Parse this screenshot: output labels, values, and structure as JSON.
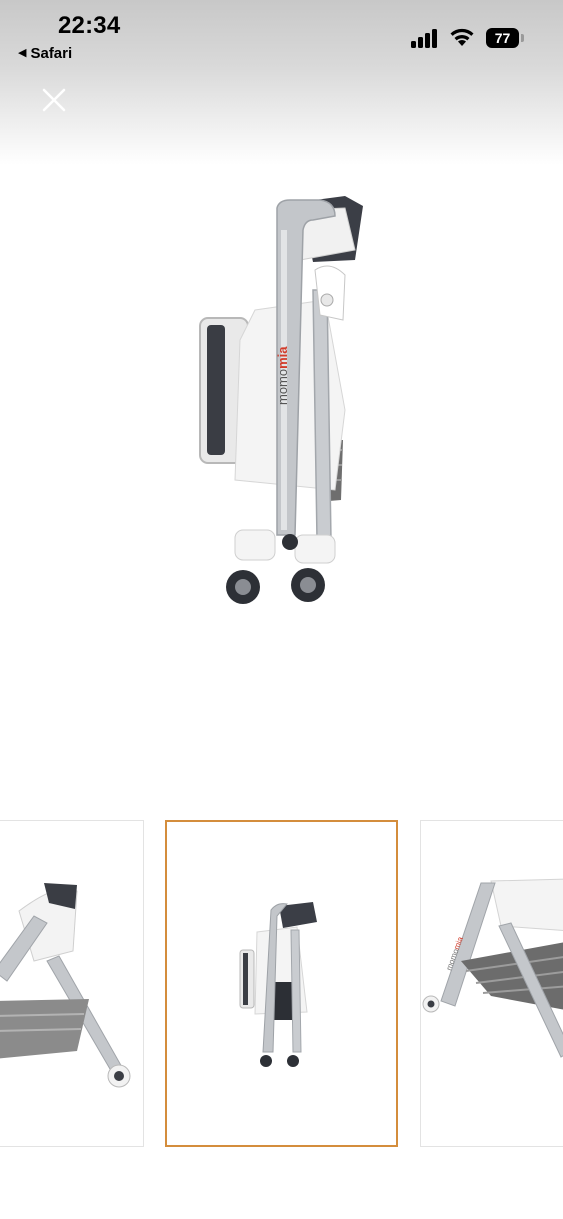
{
  "status_bar": {
    "time": "22:34",
    "back_app": "Safari",
    "battery_level": "77",
    "signal_icon": "cellular-signal-icon",
    "wifi_icon": "wifi-icon",
    "battery_icon": "battery-icon"
  },
  "viewer": {
    "close_icon": "close-icon",
    "main_image_alt": "momomia",
    "selected_thumbnail": 2,
    "thumbnails": [
      {
        "label": "",
        "selected": false
      },
      {
        "label": "",
        "selected": true
      },
      {
        "label": "",
        "selected": false
      }
    ]
  },
  "colors": {
    "selected_border": "#d48d3c",
    "brand_red": "#d23b2a",
    "frame_silver": "#b9bcc0"
  }
}
